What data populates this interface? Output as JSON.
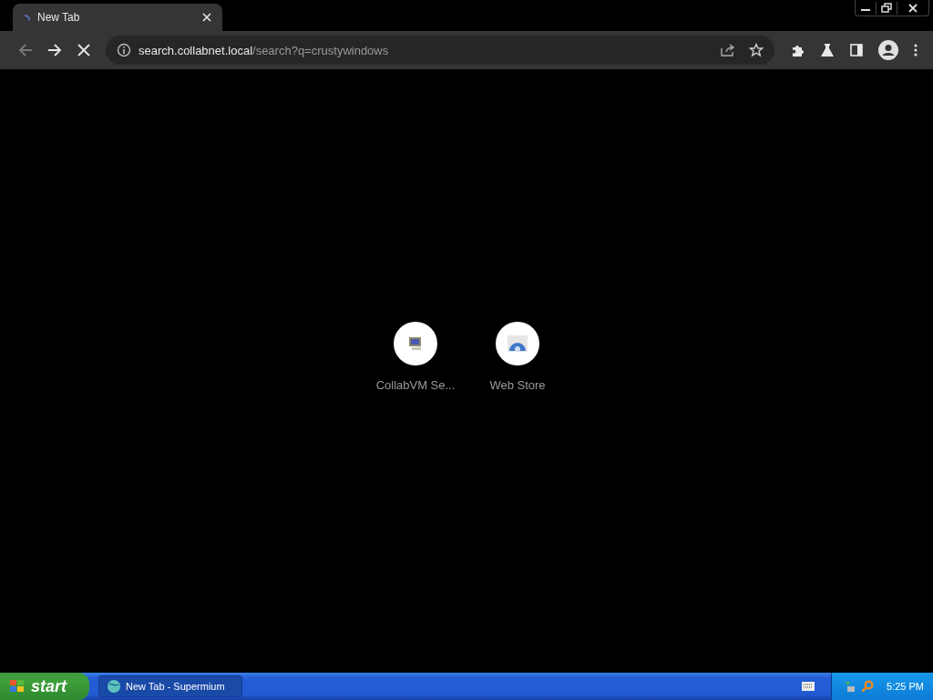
{
  "browser": {
    "tabs": [
      {
        "title": "New Tab",
        "selected": true
      }
    ],
    "loading": true,
    "url": {
      "host": "search.collabnet.local",
      "path": "/search?q=crustywindows"
    }
  },
  "shortcuts": [
    {
      "label": "CollabVM Se...",
      "kind": "computer"
    },
    {
      "label": "Web Store",
      "kind": "store"
    }
  ],
  "taskbar": {
    "start": "start",
    "tasks": [
      {
        "label": "New Tab - Supermium",
        "selected": true
      }
    ],
    "clock": "5:25 PM"
  }
}
